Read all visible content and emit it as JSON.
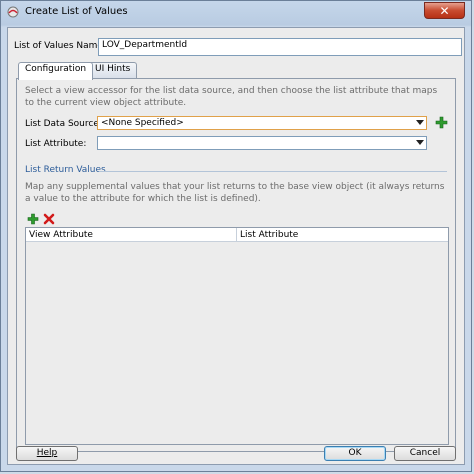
{
  "window": {
    "title": "Create List of Values"
  },
  "lov_name": {
    "label": "List of Values Name:",
    "value": "LOV_DepartmentId"
  },
  "tabs": [
    {
      "label": "Configuration",
      "active": true
    },
    {
      "label": "UI Hints",
      "active": false
    }
  ],
  "configuration": {
    "description": "Select a view accessor for the list data source, and then choose the list attribute that maps to the current view object attribute.",
    "list_data_source": {
      "label": "List Data Source:",
      "value": "<None Specified>"
    },
    "list_attribute": {
      "label": "List Attribute:",
      "value": ""
    }
  },
  "return_values": {
    "title": "List Return Values",
    "description": "Map any supplemental values that your list returns to the base view object (it always returns a value to the attribute for which the list is defined).",
    "columns": [
      "View Attribute",
      "List Attribute"
    ],
    "rows": []
  },
  "buttons": {
    "help": "Help",
    "ok": "OK",
    "cancel": "Cancel"
  },
  "colors": {
    "accent": "#2d5d9a",
    "add_green": "#2e9b2e",
    "delete_red": "#d11a1a"
  }
}
